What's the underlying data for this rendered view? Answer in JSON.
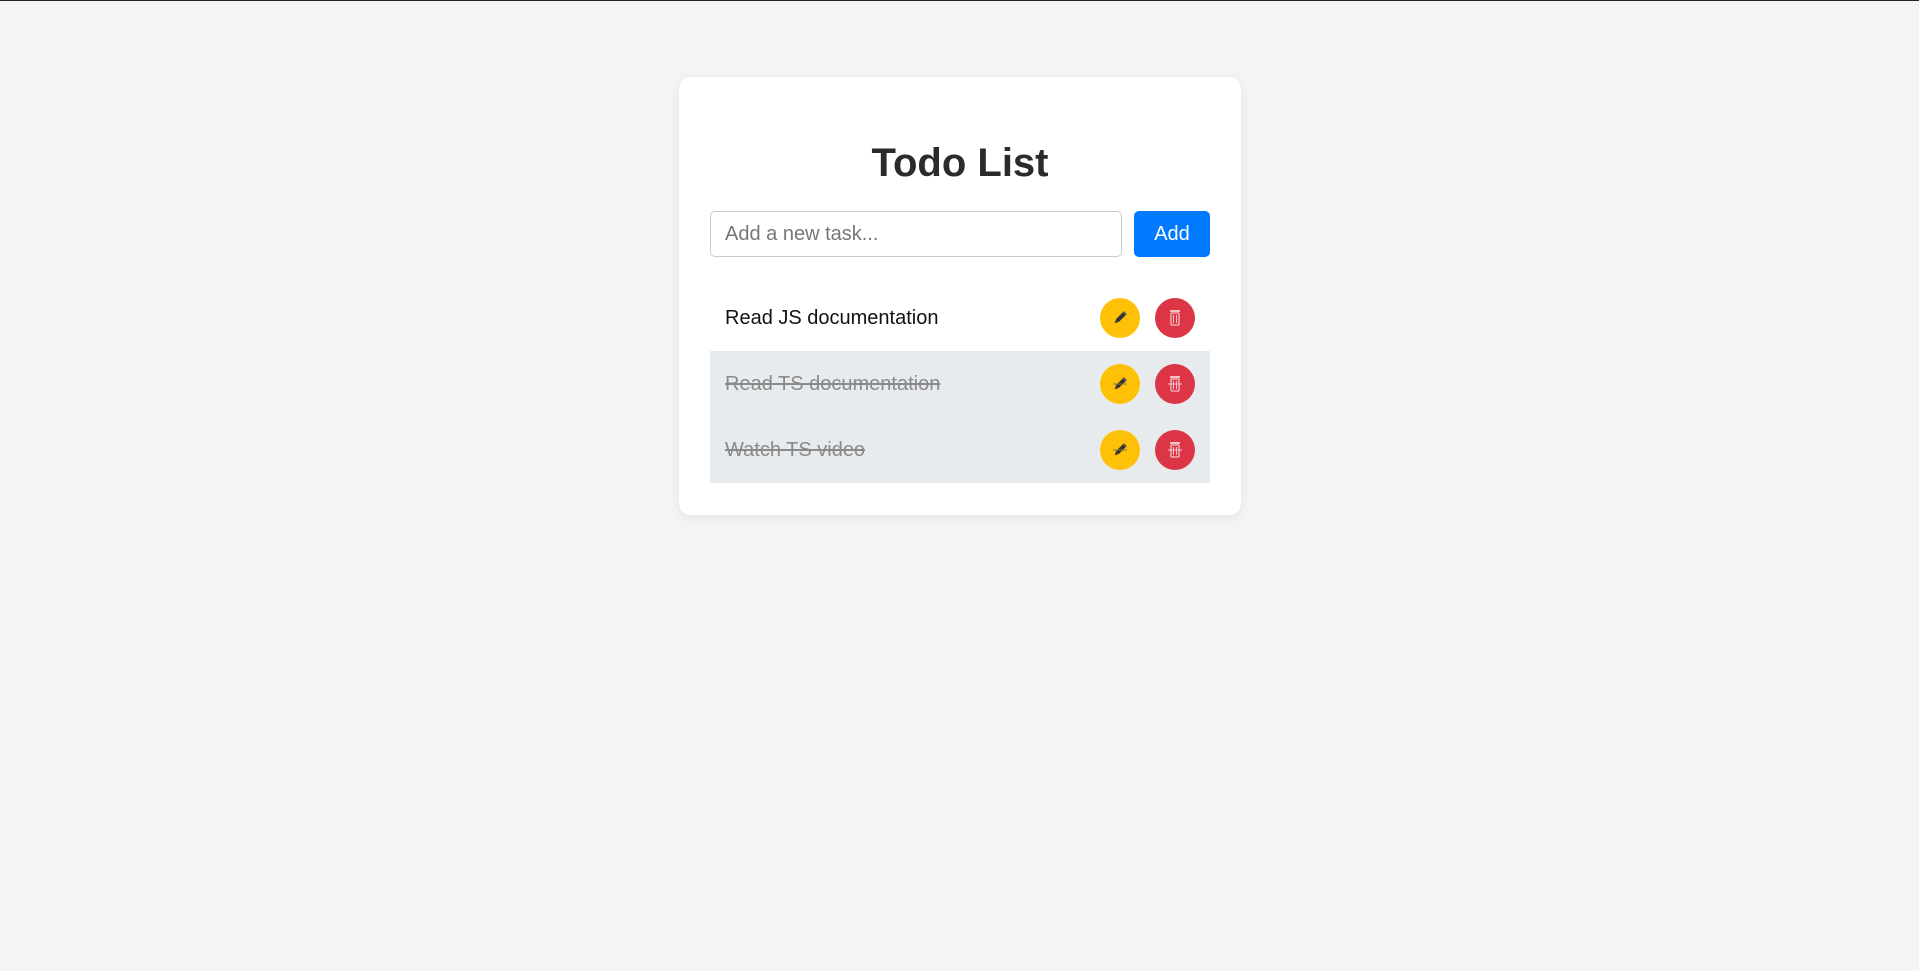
{
  "app": {
    "title": "Todo List"
  },
  "new_task": {
    "value": "",
    "placeholder": "Add a new task...",
    "add_label": "Add"
  },
  "tasks": [
    {
      "text": "Read JS documentation",
      "completed": false,
      "edit_icon": "pencil-icon",
      "delete_icon": "trash-icon"
    },
    {
      "text": "Read TS documentation",
      "completed": true,
      "edit_icon": "pencil-icon",
      "delete_icon": "trash-icon"
    },
    {
      "text": "Watch TS video",
      "completed": true,
      "edit_icon": "pencil-icon",
      "delete_icon": "trash-icon"
    }
  ],
  "colors": {
    "page_background": "#f3f4f6",
    "card_background": "#ffffff",
    "add_button": "#007bff",
    "edit_button": "#ffc107",
    "delete_button": "#dc3545",
    "completed_row": "#e8ebee"
  }
}
